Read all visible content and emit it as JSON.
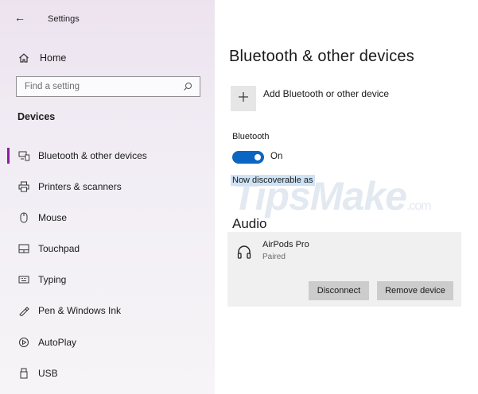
{
  "window": {
    "title": "Settings",
    "back_icon": "back-arrow-icon"
  },
  "sidebar": {
    "home_label": "Home",
    "search": {
      "placeholder": "Find a setting"
    },
    "section": "Devices",
    "items": [
      {
        "label": "Bluetooth & other devices",
        "icon": "bluetooth-devices-icon",
        "selected": true
      },
      {
        "label": "Printers & scanners",
        "icon": "printer-icon",
        "selected": false
      },
      {
        "label": "Mouse",
        "icon": "mouse-icon",
        "selected": false
      },
      {
        "label": "Touchpad",
        "icon": "touchpad-icon",
        "selected": false
      },
      {
        "label": "Typing",
        "icon": "keyboard-icon",
        "selected": false
      },
      {
        "label": "Pen & Windows Ink",
        "icon": "pen-icon",
        "selected": false
      },
      {
        "label": "AutoPlay",
        "icon": "autoplay-icon",
        "selected": false
      },
      {
        "label": "USB",
        "icon": "usb-icon",
        "selected": false
      }
    ]
  },
  "main": {
    "title": "Bluetooth & other devices",
    "add_device_label": "Add Bluetooth or other device",
    "bluetooth_label": "Bluetooth",
    "bluetooth_state": "On",
    "discoverable_text": "Now discoverable as",
    "audio_heading": "Audio",
    "device": {
      "name": "AirPods Pro",
      "status": "Paired",
      "disconnect_label": "Disconnect",
      "remove_label": "Remove device"
    }
  },
  "watermark": {
    "main": "TipsMake",
    "suffix": ".com"
  },
  "colors": {
    "accent": "#0a66c2",
    "selection_bar": "#8a1f9b",
    "sidebar_bg": "#f1ecf4",
    "button_bg": "#cccccc",
    "card_bg": "#f0f0f0"
  }
}
